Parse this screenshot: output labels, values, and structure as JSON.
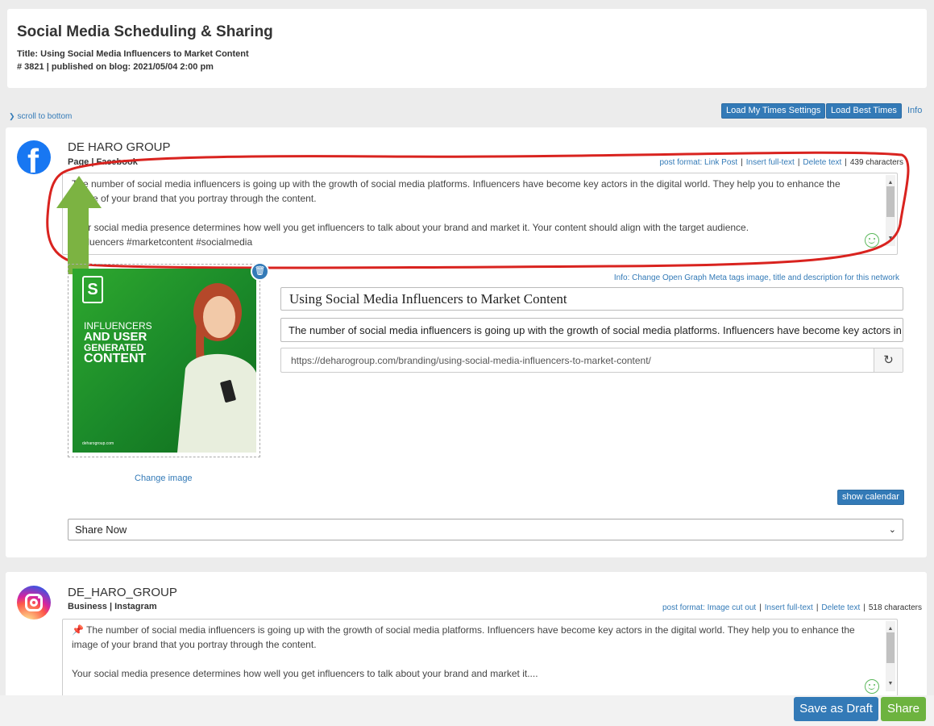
{
  "header": {
    "title": "Social Media Scheduling & Sharing",
    "post_title": "Title: Using Social Media Influencers to Market Content",
    "post_meta": "# 3821 | published on blog: 2021/05/04 2:00 pm"
  },
  "toolbar": {
    "scroll_label": "scroll to bottom",
    "load_my_times": "Load My Times Settings",
    "load_best_times": "Load Best Times",
    "info": "Info"
  },
  "facebook": {
    "account_name": "DE HARO GROUP",
    "account_type": "Page | Facebook",
    "post_format": "post format: Link Post",
    "insert_full_text": "Insert full-text",
    "delete_text": "Delete text",
    "char_count": "439 characters",
    "text_line1": "The number of social media influencers is going up with the growth of social media platforms. Influencers have become key actors in the digital world. They help you to enhance the image of your brand that you portray through the content.",
    "text_line2": "Your social media presence determines how well you get influencers to talk about your brand and market it. Your content should align with the target audience.",
    "text_line3": "#influencers #marketcontent #socialmedia",
    "og_info": "Info: Change Open Graph Meta tags image, title and description for this network",
    "og_title": "Using Social Media Influencers to Market Content",
    "og_description": "The number of social media influencers is going up with the growth of social media platforms. Influencers have become key actors in the digital world.",
    "og_url": "https://deharogroup.com/branding/using-social-media-influencers-to-market-content/",
    "change_image": "Change image",
    "show_calendar": "show calendar",
    "share_option": "Share Now",
    "image_text": {
      "line1": "INFLUENCERS",
      "line2": "AND USER",
      "line3": "GENERATED",
      "line4": "CONTENT",
      "footer": "deharogroup.com"
    }
  },
  "instagram": {
    "account_name": "DE_HARO_GROUP",
    "account_type": "Business | Instagram",
    "post_format": "post format: Image cut out",
    "insert_full_text": "Insert full-text",
    "delete_text": "Delete text",
    "char_count": "518 characters",
    "text_line1": "The number of social media influencers is going up with the growth of social media platforms. Influencers have become key actors in the digital world. They help you to enhance the image of your brand that you portray through the content.",
    "text_line2": "Your social media presence determines how well you get influencers to talk about your brand and market it...."
  },
  "footer": {
    "save_draft": "Save as Draft",
    "share": "Share"
  },
  "colors": {
    "primary": "#337ab7",
    "success": "#6db33f",
    "facebook": "#1877f2",
    "annotation_red": "#d9231f",
    "annotation_green": "#7cb342"
  }
}
